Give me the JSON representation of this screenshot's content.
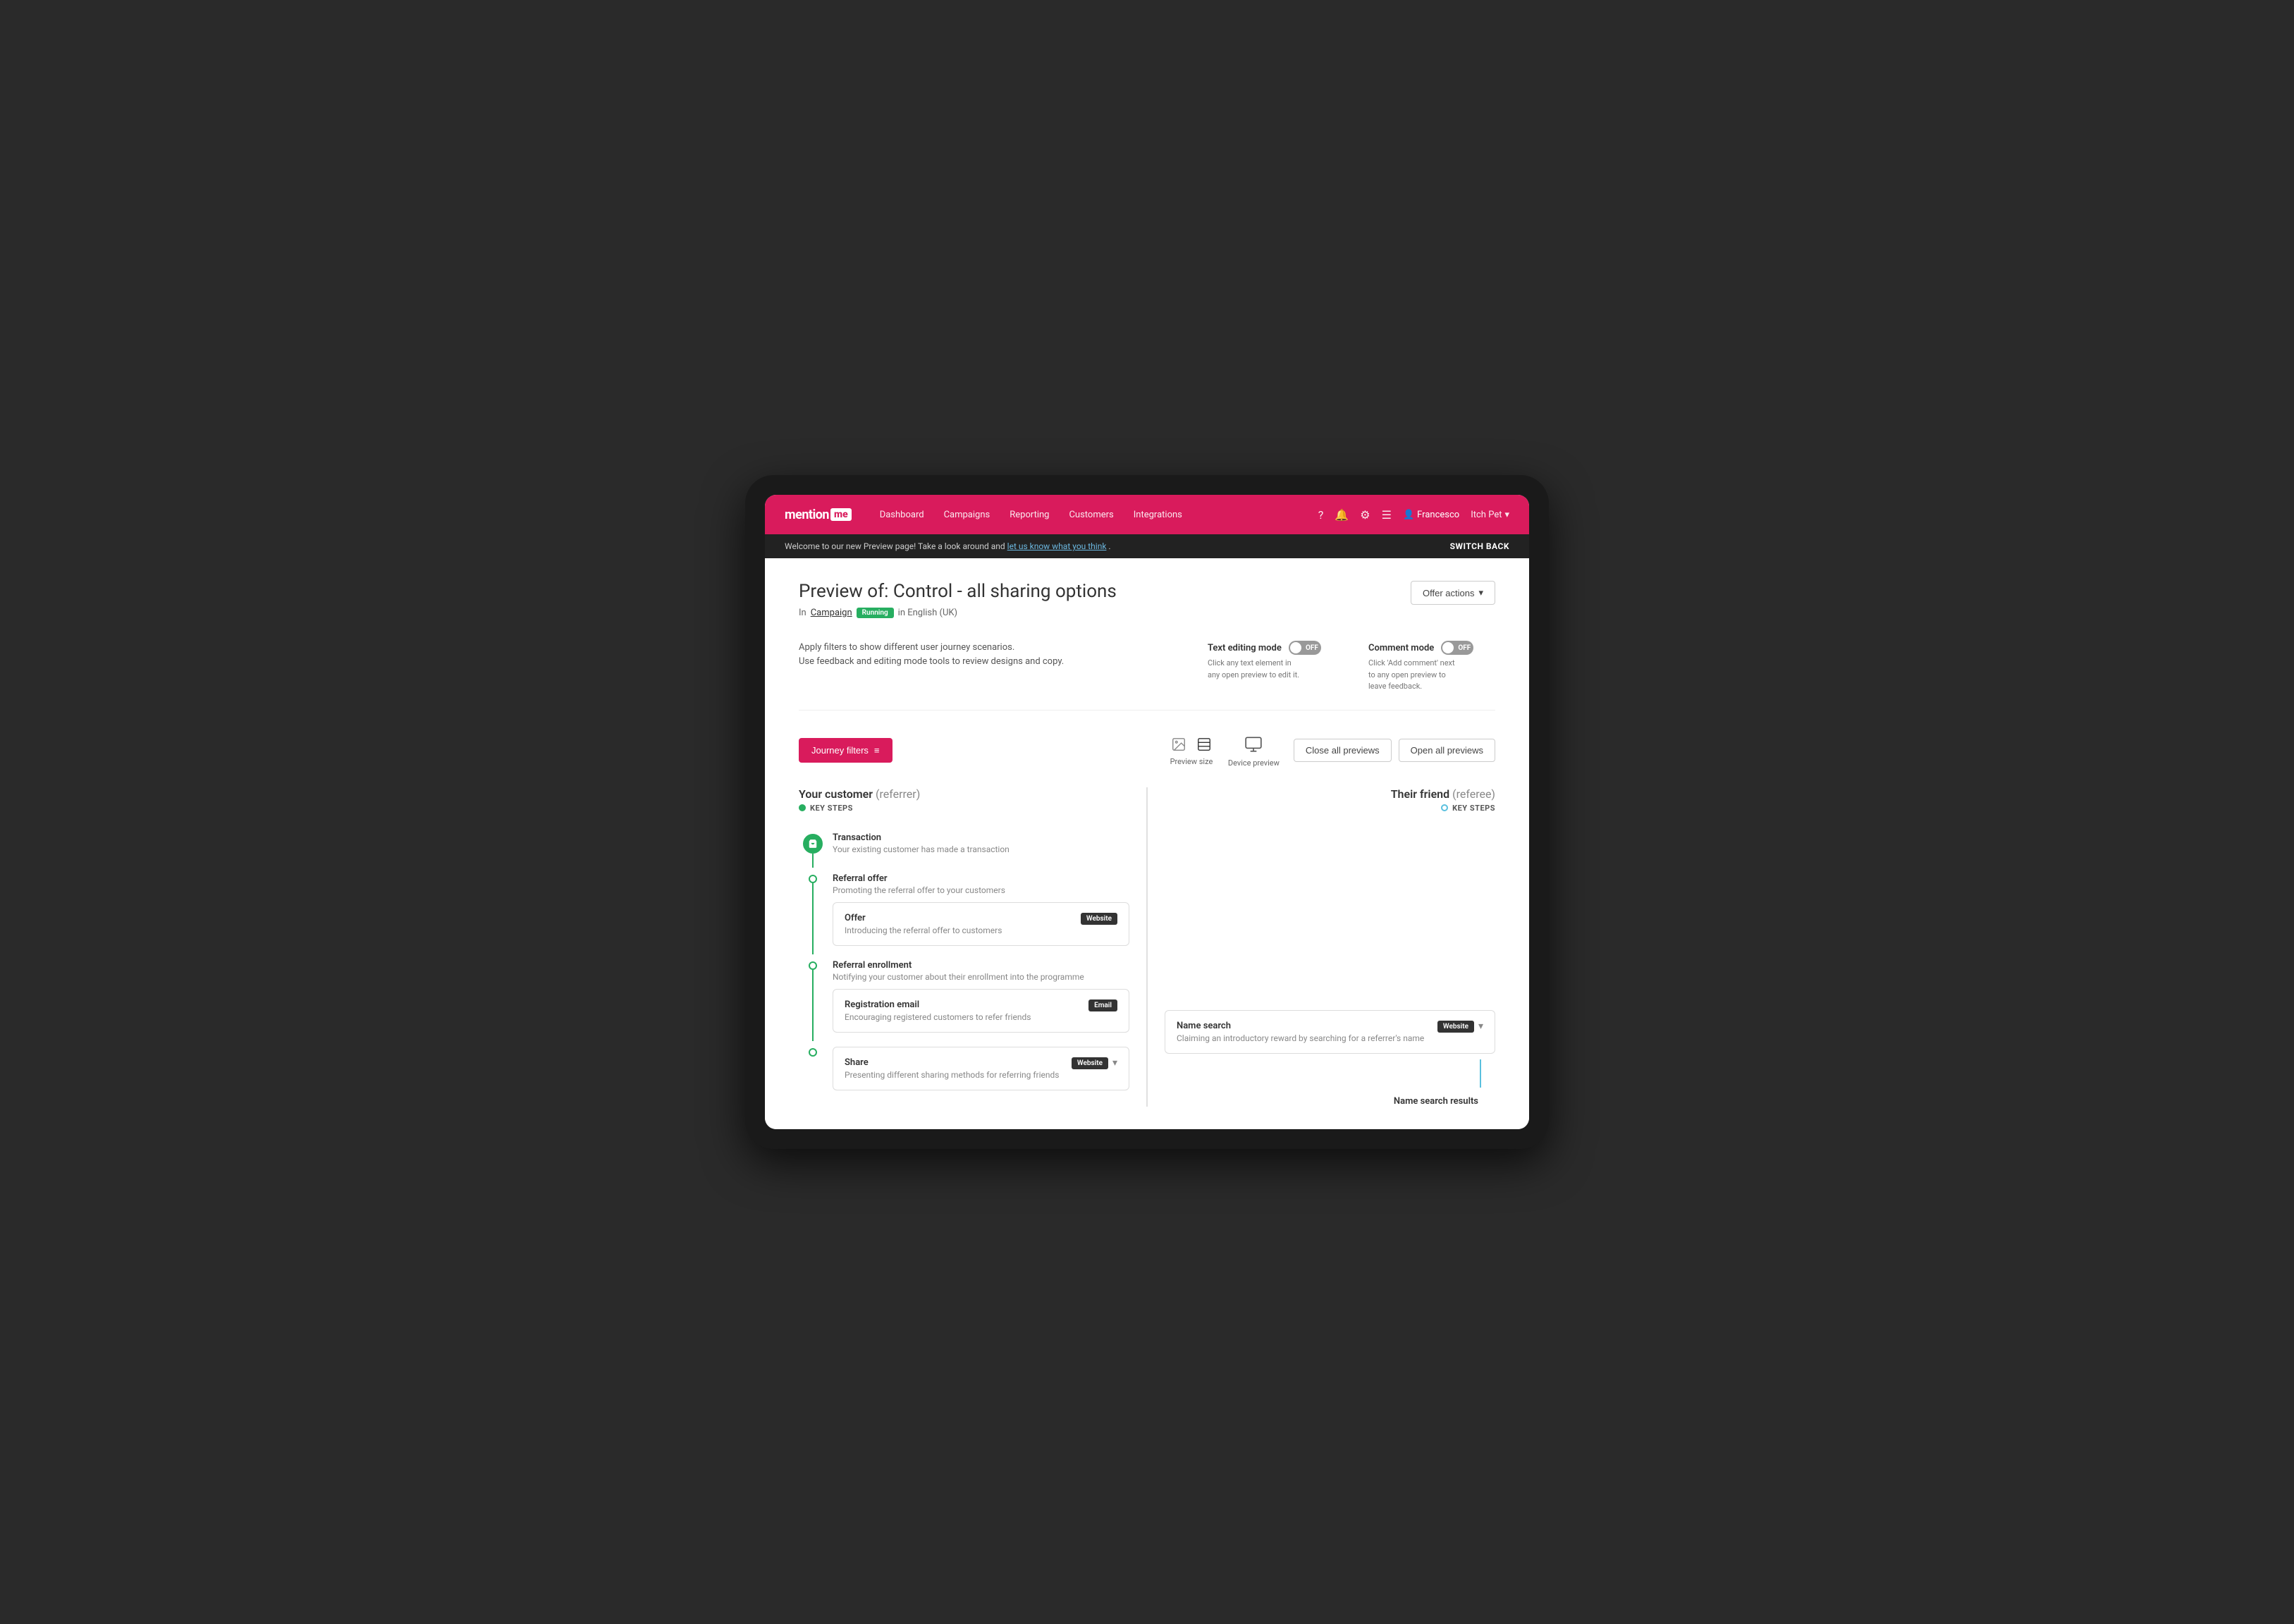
{
  "nav": {
    "logo_text": "mention",
    "logo_box": "me",
    "links": [
      "Dashboard",
      "Campaigns",
      "Reporting",
      "Customers",
      "Integrations"
    ],
    "user": "Francesco",
    "tenant": "Itch Pet",
    "switch_back": "SWITCH BACK"
  },
  "banner": {
    "text": "Welcome to our new Preview page! Take a look around and ",
    "link_text": "let us know what you think",
    "text_after": "."
  },
  "page": {
    "title": "Preview of: Control - all sharing options",
    "subtitle_in": "In",
    "subtitle_campaign": "Campaign",
    "subtitle_running": "Running",
    "subtitle_lang": "in English (UK)"
  },
  "offer_actions": {
    "label": "Offer actions"
  },
  "modes": {
    "description_line1": "Apply filters to show different user journey scenarios.",
    "description_line2": "Use feedback and editing mode tools to review designs and copy.",
    "text_editing": {
      "label": "Text editing mode",
      "toggle_label": "OFF",
      "desc_line1": "Click any text element in",
      "desc_line2": "any open preview to edit it."
    },
    "comment": {
      "label": "Comment mode",
      "toggle_label": "OFF",
      "desc_line1": "Click 'Add comment' next",
      "desc_line2": "to any open preview to",
      "desc_line3": "leave feedback."
    }
  },
  "toolbar": {
    "journey_filters": "Journey filters",
    "preview_size_label": "Preview size",
    "device_preview_label": "Device preview",
    "close_all": "Close all previews",
    "open_all": "Open all previews"
  },
  "journey": {
    "referrer_title": "Your customer",
    "referrer_subtitle": "(referrer)",
    "referrer_key_steps": "KEY STEPS",
    "referee_title": "Their friend",
    "referee_subtitle": "(referee)",
    "referee_key_steps": "KEY STEPS",
    "steps": [
      {
        "id": "transaction",
        "title": "Transaction",
        "desc": "Your existing customer has made a transaction",
        "type": "circle-filled"
      },
      {
        "id": "referral-offer",
        "title": "Referral offer",
        "desc": "Promoting the referral offer to your customers",
        "type": "dot",
        "cards": [
          {
            "title": "Offer",
            "desc": "Introducing the referral offer to customers",
            "badge": "Website",
            "badge_type": "website",
            "has_chevron": false
          }
        ]
      },
      {
        "id": "referral-enrollment",
        "title": "Referral enrollment",
        "desc": "Notifying your customer about their enrollment into the programme",
        "type": "dot",
        "cards": [
          {
            "title": "Registration email",
            "desc": "Encouraging registered customers to refer friends",
            "badge": "Email",
            "badge_type": "email",
            "has_chevron": false
          }
        ]
      },
      {
        "id": "share",
        "title": "Share",
        "desc": "Presenting different sharing methods for referring friends",
        "type": "dot",
        "cards": [
          {
            "title": "Share",
            "desc": "Presenting different sharing methods for referring friends",
            "badge": "Website",
            "badge_type": "website",
            "has_chevron": true
          }
        ]
      }
    ],
    "referee_steps": [
      {
        "id": "name-search",
        "title": "Name search",
        "desc": "Claiming an introductory reward by searching for a referrer's name",
        "badge": "Website",
        "has_chevron": true
      }
    ],
    "name_search_results": "Name search results"
  }
}
